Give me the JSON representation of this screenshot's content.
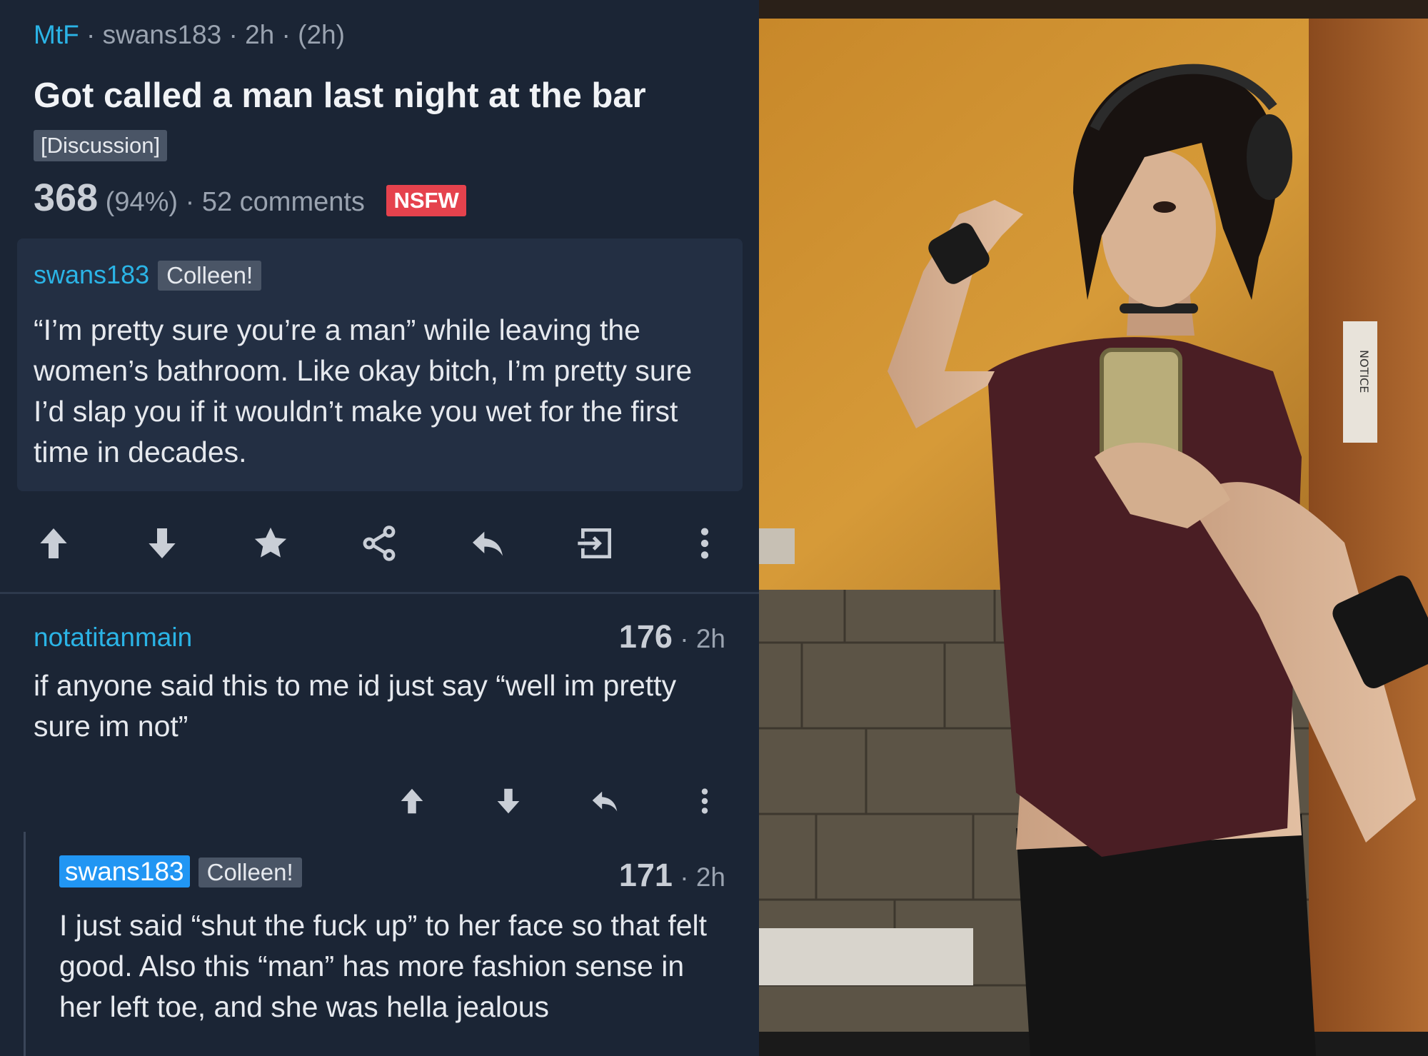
{
  "post": {
    "subreddit": "MtF",
    "author": "swans183",
    "age": "2h",
    "edited_age": "(2h)",
    "title": "Got called a man last night at the bar",
    "flair": "[Discussion]",
    "score": "368",
    "upvote_ratio": "(94%)",
    "comments": "52 comments",
    "nsfw": "NSFW",
    "selftext_author": "swans183",
    "selftext_author_flair": "Colleen!",
    "selftext": "“I’m pretty sure you’re a man” while leaving the women’s bathroom. Like okay bitch, I’m pretty sure I’d slap you if it wouldn’t make you wet for the first time in decades."
  },
  "post_actions": [
    {
      "name": "upvote-icon",
      "label": "Upvote"
    },
    {
      "name": "downvote-icon",
      "label": "Downvote"
    },
    {
      "name": "star-icon",
      "label": "Save"
    },
    {
      "name": "share-icon",
      "label": "Share"
    },
    {
      "name": "reply-icon",
      "label": "Reply"
    },
    {
      "name": "open-icon",
      "label": "Open"
    },
    {
      "name": "more-icon",
      "label": "More"
    }
  ],
  "comments": [
    {
      "author": "notatitanmain",
      "score": "176",
      "age": "2h",
      "body": "if anyone said this to me id just say “well im pretty sure im not”"
    },
    {
      "author": "swans183",
      "author_flair": "Colleen!",
      "is_op": true,
      "score": "171",
      "age": "2h",
      "body": "I just said “shut the fuck up” to her face so that felt good. Also this “man” has more fashion sense in her left toe, and she was hella jealous"
    }
  ],
  "colors": {
    "background": "#1b2535",
    "card": "#232f43",
    "accent": "#2bb4e6",
    "op_badge": "#2196f3",
    "nsfw": "#e5424d",
    "muted_text": "#9aa3b0"
  },
  "photo": {
    "sign_text": "NOTICE"
  }
}
